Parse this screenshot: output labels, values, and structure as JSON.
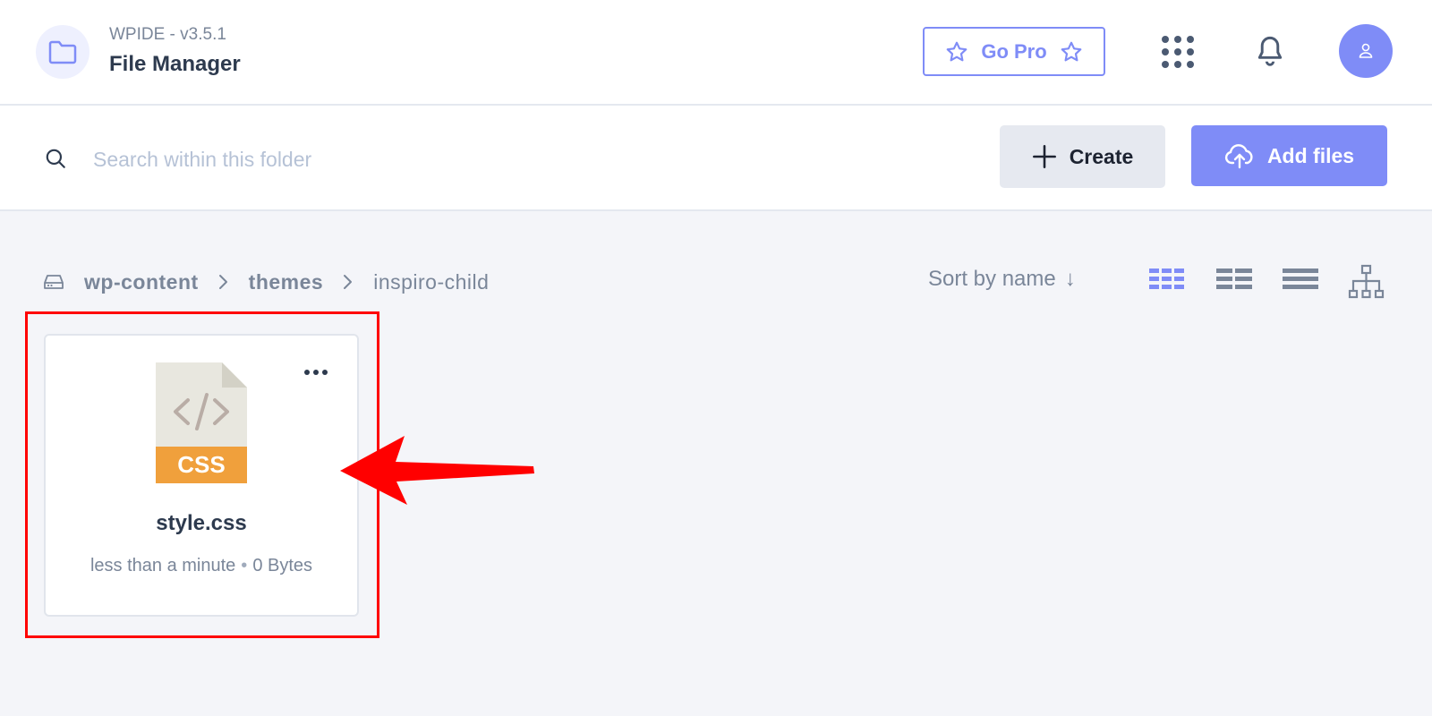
{
  "header": {
    "version": "WPIDE - v3.5.1",
    "title": "File Manager",
    "go_pro_label": "Go Pro",
    "icons": {
      "logo": "folder-icon",
      "apps": "grid-dots-icon",
      "notifications": "bell-icon",
      "avatar": "user-icon"
    }
  },
  "toolbar": {
    "search_placeholder": "Search within this folder",
    "search_value": "",
    "create_label": "Create",
    "add_files_label": "Add files"
  },
  "breadcrumb": {
    "items": [
      "wp-content",
      "themes",
      "inspiro-child"
    ]
  },
  "sort": {
    "label": "Sort by name",
    "direction_glyph": "↓"
  },
  "views": [
    "grid-view-icon",
    "compact-view-icon",
    "list-view-icon",
    "tree-view-icon"
  ],
  "files": [
    {
      "name": "style.css",
      "type_label": "CSS",
      "modified": "less than a minute",
      "size": "0 Bytes"
    }
  ],
  "colors": {
    "accent": "#7f8cf7",
    "text_dark": "#2d3a4e",
    "text_muted": "#7a8699",
    "css_badge": "#f0a03c",
    "annotation_red": "#ff0000"
  }
}
